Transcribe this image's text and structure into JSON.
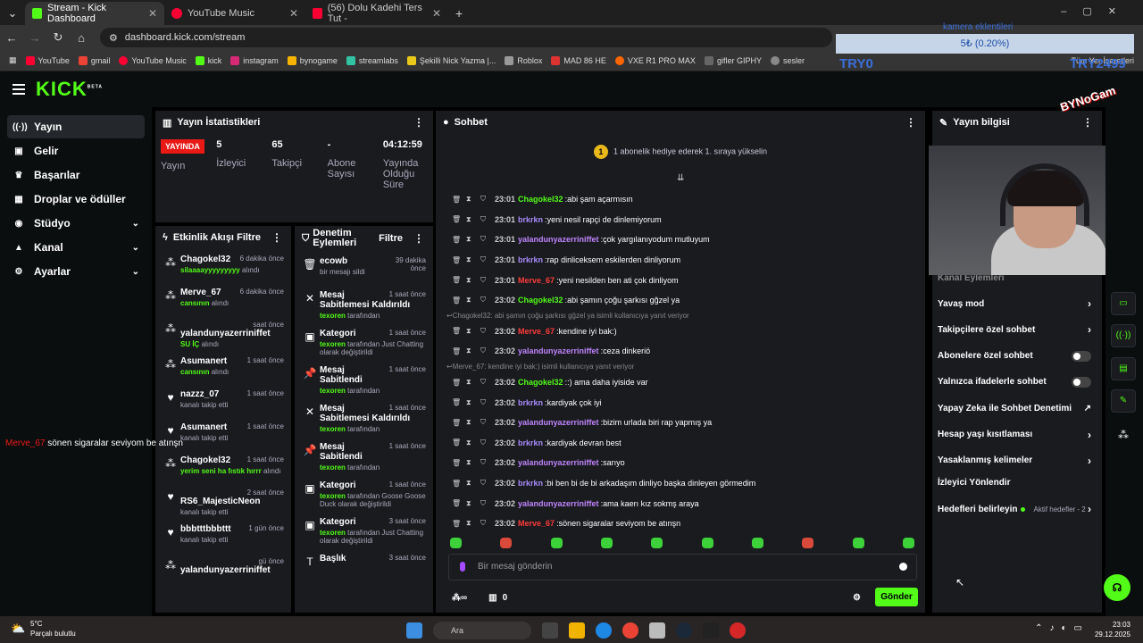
{
  "browser": {
    "tabs": [
      {
        "title": "Stream - Kick Dashboard",
        "color": "#53fc18"
      },
      {
        "title": "YouTube Music",
        "color": "#ff0033"
      },
      {
        "title": "(56) Dolu Kadehi Ters Tut -",
        "color": "#ff0033"
      }
    ],
    "url": "dashboard.kick.com/stream",
    "bookmarks": [
      "YouTube",
      "gmail",
      "YouTube Music",
      "kick",
      "instagram",
      "bynogame",
      "streamlabs",
      "Şekilli Nick Yazma |...",
      "Roblox",
      "MAD 86 HE",
      "VXE R1 PRO MAX",
      "gifler GIPHY",
      "sesler"
    ],
    "bookmarks_right": "Tüm Yer İşaretleri"
  },
  "overlays": {
    "goal_label": "kamera eklentileri",
    "goal_value": "5₺ (0.20%)",
    "try_left": "TRY0",
    "try_right": "TRY2499",
    "brand": "BYNoGam",
    "chat_user": "Merve_67",
    "chat_text": " sönen sigaralar seviyom be atınşn"
  },
  "app": {
    "logo": "KICK",
    "logo_sup": "BETA"
  },
  "sidebar": {
    "items": [
      {
        "label": "Yayın",
        "icon": "((·))",
        "active": true
      },
      {
        "label": "Gelir",
        "icon": "▣"
      },
      {
        "label": "Başarılar",
        "icon": "♛"
      },
      {
        "label": "Droplar ve ödüller",
        "icon": "▦"
      },
      {
        "label": "Stüdyo",
        "icon": "◉",
        "chev": true
      },
      {
        "label": "Kanal",
        "icon": "▲",
        "chev": true
      },
      {
        "label": "Ayarlar",
        "icon": "⚙",
        "chev": true
      }
    ]
  },
  "stats": {
    "title": "Yayın İstatistikleri",
    "live_badge": "YAYINDA",
    "items": [
      {
        "value": "",
        "label": "Yayın"
      },
      {
        "value": "5",
        "label": "İzleyici"
      },
      {
        "value": "65",
        "label": "Takipçi"
      },
      {
        "value": "-",
        "label": "Abone Sayısı"
      },
      {
        "value": "04:12:59",
        "label": "Yayında Olduğu Süre"
      }
    ]
  },
  "activity": {
    "title": "Etkinlik Akışı",
    "filter": "Filtre",
    "items": [
      {
        "name": "Chagokel32",
        "time": "6 dakika önce",
        "gift": "silaaaayyyyyyyyy",
        "suffix": "alındı",
        "icon": "sub"
      },
      {
        "name": "Merve_67",
        "time": "6 dakika önce",
        "gift": "cansının",
        "suffix": "alındı",
        "icon": "sub"
      },
      {
        "name": "yalandunyazerriniffet",
        "time": "saat önce",
        "gift": "SU İÇ",
        "suffix": "alındı",
        "icon": "sub"
      },
      {
        "name": "Asumanert",
        "time": "1 saat önce",
        "gift": "cansının",
        "suffix": "alındı",
        "icon": "sub"
      },
      {
        "name": "nazzz_07",
        "time": "1 saat önce",
        "gift": "",
        "suffix": "kanalı takip etti",
        "icon": "heart"
      },
      {
        "name": "Asumanert",
        "time": "1 saat önce",
        "gift": "",
        "suffix": "kanalı takip etti",
        "icon": "heart"
      },
      {
        "name": "Chagokel32",
        "time": "1 saat önce",
        "gift": "yerim seni ha fıstık hırrr",
        "suffix": "alındı",
        "icon": "sub"
      },
      {
        "name": "RS6_MajesticNeon",
        "time": "2 saat önce",
        "gift": "",
        "suffix": "kanalı takip etti",
        "icon": "heart"
      },
      {
        "name": "bbbtttbbbttt",
        "time": "1 gün önce",
        "gift": "",
        "suffix": "kanalı takip etti",
        "icon": "heart"
      },
      {
        "name": "yalandunyazerriniffet",
        "time": "gü önce",
        "gift": "",
        "suffix": "",
        "icon": "sub"
      }
    ]
  },
  "moderation": {
    "title": "Denetim Eylemleri",
    "filter": "Filtre",
    "items": [
      {
        "title": "ecowb",
        "time": "39 dakika önce",
        "sub": "bir mesajı sildi",
        "icon": "🗑"
      },
      {
        "title": "Mesaj Sabitlemesi Kaldırıldı",
        "time": "1 saat önce",
        "who": "texoren",
        "sub": "tarafından",
        "icon": "✕"
      },
      {
        "title": "Kategori",
        "time": "1 saat önce",
        "who": "texoren",
        "sub": "tarafından Just Chatting olarak değiştirildi",
        "icon": "▣"
      },
      {
        "title": "Mesaj Sabitlendi",
        "time": "1 saat önce",
        "who": "texoren",
        "sub": "tarafından",
        "icon": "📌"
      },
      {
        "title": "Mesaj Sabitlemesi Kaldırıldı",
        "time": "1 saat önce",
        "who": "texoren",
        "sub": "tarafından",
        "icon": "✕"
      },
      {
        "title": "Mesaj Sabitlendi",
        "time": "1 saat önce",
        "who": "texoren",
        "sub": "tarafından",
        "icon": "📌"
      },
      {
        "title": "Kategori",
        "time": "1 saat önce",
        "who": "texoren",
        "sub": "tarafından Goose Goose Duck olarak değiştirildi",
        "icon": "▣"
      },
      {
        "title": "Kategori",
        "time": "3 saat önce",
        "who": "texoren",
        "sub": "tarafından Just Chatting olarak değiştirildi",
        "icon": "▣"
      },
      {
        "title": "Başlık",
        "time": "3 saat önce",
        "who": "",
        "sub": "",
        "icon": "T"
      }
    ]
  },
  "chat": {
    "title": "Sohbet",
    "pinned": "1 abonelik hediye ederek 1. sıraya yükselin",
    "pinned_rank": "1",
    "messages": [
      {
        "time": "23:01",
        "user": "Chagokel32",
        "color": "#53fc18",
        "text": "abi şam açarmısın"
      },
      {
        "time": "23:01",
        "user": "brkrkn",
        "color": "#a78bfa",
        "text": "yeni nesil rapçi de dinlemiyorum"
      },
      {
        "time": "23:01",
        "user": "yalandunyazerriniffet",
        "color": "#c084fc",
        "text": "çok yargılanıyodum mutluyum"
      },
      {
        "time": "23:01",
        "user": "brkrkn",
        "color": "#a78bfa",
        "text": "rap dinliceksem eskilerden dinliyorum"
      },
      {
        "time": "23:01",
        "user": "Merve_67",
        "color": "#ff3b3b",
        "text": "yeni nesilden ben ati çok dinliyom"
      },
      {
        "time": "23:02",
        "user": "Chagokel32",
        "color": "#53fc18",
        "text": "abi şamın çoğu şarkısı gğzel ya"
      },
      {
        "reply": "Chagokel32: abi şamın çoğu şarkısı gğzel ya isimli kullanıcıya yanıt veriyor"
      },
      {
        "time": "23:02",
        "user": "Merve_67",
        "color": "#ff3b3b",
        "text": "kendine iyi bak:)"
      },
      {
        "time": "23:02",
        "user": "yalandunyazerriniffet",
        "color": "#c084fc",
        "text": "ceza dinkeriö"
      },
      {
        "reply": "Merve_67: kendine iyi bak:) isimli kullanıcıya yanıt veriyor"
      },
      {
        "time": "23:02",
        "user": "Chagokel32",
        "color": "#53fc18",
        "text": ":) ama daha iyiside var"
      },
      {
        "time": "23:02",
        "user": "brkrkn",
        "color": "#a78bfa",
        "text": "kardiyak çok iyi"
      },
      {
        "time": "23:02",
        "user": "yalandunyazerriniffet",
        "color": "#c084fc",
        "text": "bizim urlada biri rap yapmış ya"
      },
      {
        "time": "23:02",
        "user": "brkrkn",
        "color": "#a78bfa",
        "text": "kardiyak devran best"
      },
      {
        "time": "23:02",
        "user": "yalandunyazerriniffet",
        "color": "#c084fc",
        "text": "sarıyo"
      },
      {
        "time": "23:02",
        "user": "brkrkn",
        "color": "#a78bfa",
        "text": "bi ben bi de bi arkadaşım dinliyo başka dinleyen görmedim"
      },
      {
        "time": "23:02",
        "user": "yalandunyazerriniffet",
        "color": "#c084fc",
        "text": "ama kaerı kız sokmş araya"
      },
      {
        "time": "23:02",
        "user": "Merve_67",
        "color": "#ff3b3b",
        "text": "sönen sigaralar seviyom be atınşn"
      }
    ],
    "input_placeholder": "Bir mesaj gönderin",
    "points": "0",
    "send": "Gönder"
  },
  "info": {
    "title": "Yayın bilgisi",
    "partial": "Kanal Eylemleri",
    "rows": [
      {
        "label": "Yavaş mod",
        "type": "chev"
      },
      {
        "label": "Takipçilere özel sohbet",
        "type": "chev"
      },
      {
        "label": "Abonelere özel sohbet",
        "type": "toggle"
      },
      {
        "label": "Yalnızca ifadelerle sohbet",
        "type": "toggle"
      },
      {
        "label": "Yapay Zeka ile Sohbet Denetimi",
        "type": "ext"
      },
      {
        "label": "Hesap yaşı kısıtlaması",
        "type": "chev"
      },
      {
        "label": "Yasaklanmış kelimeler",
        "type": "chev"
      },
      {
        "label": "İzleyici Yönlendir",
        "type": "none"
      },
      {
        "label": "Hedefleri belirleyin",
        "type": "goal"
      }
    ],
    "goal_status": "Aktif hedefler - 2"
  },
  "taskbar": {
    "temp": "5°C",
    "weather": "Parçalı bulutlu",
    "search": "Ara",
    "time": "23:03",
    "date": "29.12.2025"
  }
}
